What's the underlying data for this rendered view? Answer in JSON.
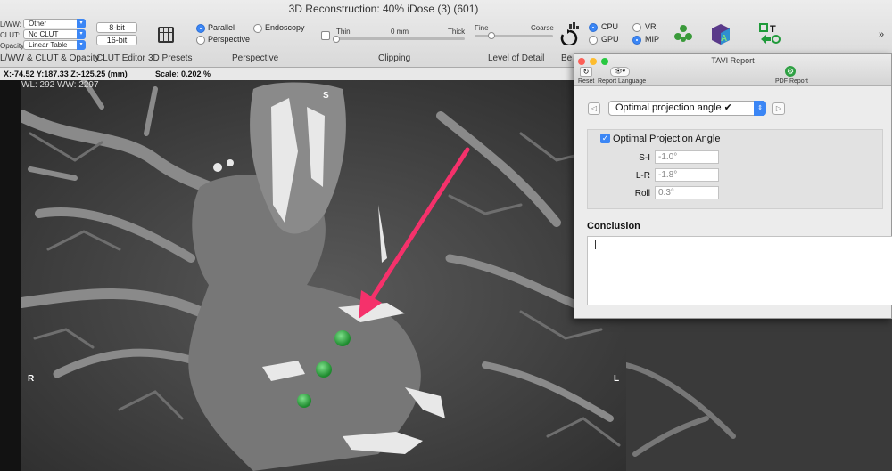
{
  "window_title": "3D Reconstruction: 40% iDose (3) (601)",
  "wlww": {
    "rows": [
      {
        "label": "L/WW:",
        "value": "Other"
      },
      {
        "label": "CLUT:",
        "value": "No CLUT"
      },
      {
        "label": "Opacity:",
        "value": "Linear Table"
      }
    ],
    "section_label": "L/WW & CLUT & Opacity"
  },
  "clut_editor": {
    "btn_8bit": "8-bit",
    "btn_16bit": "16-bit",
    "section_label": "CLUT Editor"
  },
  "presets": {
    "section_label": "3D Presets"
  },
  "perspective": {
    "parallel": "Parallel",
    "perspective": "Perspective",
    "endoscopy": "Endoscopy",
    "section_label": "Perspective",
    "selected": "Parallel"
  },
  "clipping": {
    "thin": "Thin",
    "mm": "0 mm",
    "thick": "Thick",
    "section_label": "Clipping"
  },
  "lod": {
    "fine": "Fine",
    "coarse": "Coarse",
    "section_label": "Level of Detail"
  },
  "best": {
    "section_label": "Be"
  },
  "engine": {
    "cpu": "CPU",
    "gpu": "GPU",
    "vr": "VR",
    "mip": "MIP",
    "selected_engine": "CPU",
    "selected_mode": "MIP"
  },
  "overflow": "»",
  "infobar": {
    "coords": "X:-74.52 Y:187.33 Z:-125.25 (mm)",
    "scale": "Scale: 0.202 %"
  },
  "viewer": {
    "wlww": "WL: 292 WW: 2297",
    "top": "S",
    "left": "R",
    "right": "L"
  },
  "panel": {
    "title": "TAVI Report",
    "reset": "Reset",
    "report_language": "Report Language",
    "pdf_report": "PDF Report",
    "dropdown": "Optimal projection angle ✔",
    "checkbox_label": "Optimal Projection Angle",
    "fields": [
      {
        "label": "S-I",
        "value": "-1.0°"
      },
      {
        "label": "L-R",
        "value": "-1.8°"
      },
      {
        "label": "Roll",
        "value": "0.3°"
      }
    ],
    "conclusion": "Conclusion"
  },
  "colors": {
    "accent": "#3b86f5",
    "arrow": "#f5316b",
    "green_icon": "#2ea043"
  }
}
